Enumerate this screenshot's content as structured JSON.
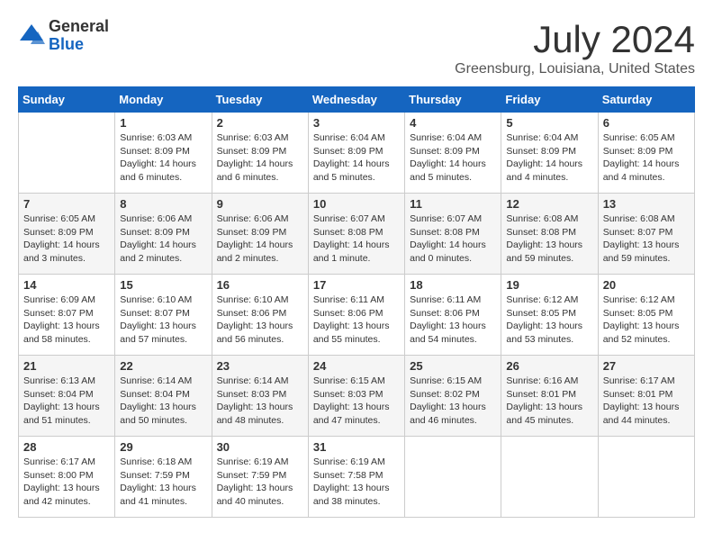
{
  "header": {
    "logo": {
      "general": "General",
      "blue": "Blue"
    },
    "month_title": "July 2024",
    "location": "Greensburg, Louisiana, United States"
  },
  "calendar": {
    "weekdays": [
      "Sunday",
      "Monday",
      "Tuesday",
      "Wednesday",
      "Thursday",
      "Friday",
      "Saturday"
    ],
    "weeks": [
      [
        {
          "day": "",
          "sunrise": "",
          "sunset": "",
          "daylight": ""
        },
        {
          "day": "1",
          "sunrise": "Sunrise: 6:03 AM",
          "sunset": "Sunset: 8:09 PM",
          "daylight": "Daylight: 14 hours and 6 minutes."
        },
        {
          "day": "2",
          "sunrise": "Sunrise: 6:03 AM",
          "sunset": "Sunset: 8:09 PM",
          "daylight": "Daylight: 14 hours and 6 minutes."
        },
        {
          "day": "3",
          "sunrise": "Sunrise: 6:04 AM",
          "sunset": "Sunset: 8:09 PM",
          "daylight": "Daylight: 14 hours and 5 minutes."
        },
        {
          "day": "4",
          "sunrise": "Sunrise: 6:04 AM",
          "sunset": "Sunset: 8:09 PM",
          "daylight": "Daylight: 14 hours and 5 minutes."
        },
        {
          "day": "5",
          "sunrise": "Sunrise: 6:04 AM",
          "sunset": "Sunset: 8:09 PM",
          "daylight": "Daylight: 14 hours and 4 minutes."
        },
        {
          "day": "6",
          "sunrise": "Sunrise: 6:05 AM",
          "sunset": "Sunset: 8:09 PM",
          "daylight": "Daylight: 14 hours and 4 minutes."
        }
      ],
      [
        {
          "day": "7",
          "sunrise": "Sunrise: 6:05 AM",
          "sunset": "Sunset: 8:09 PM",
          "daylight": "Daylight: 14 hours and 3 minutes."
        },
        {
          "day": "8",
          "sunrise": "Sunrise: 6:06 AM",
          "sunset": "Sunset: 8:09 PM",
          "daylight": "Daylight: 14 hours and 2 minutes."
        },
        {
          "day": "9",
          "sunrise": "Sunrise: 6:06 AM",
          "sunset": "Sunset: 8:09 PM",
          "daylight": "Daylight: 14 hours and 2 minutes."
        },
        {
          "day": "10",
          "sunrise": "Sunrise: 6:07 AM",
          "sunset": "Sunset: 8:08 PM",
          "daylight": "Daylight: 14 hours and 1 minute."
        },
        {
          "day": "11",
          "sunrise": "Sunrise: 6:07 AM",
          "sunset": "Sunset: 8:08 PM",
          "daylight": "Daylight: 14 hours and 0 minutes."
        },
        {
          "day": "12",
          "sunrise": "Sunrise: 6:08 AM",
          "sunset": "Sunset: 8:08 PM",
          "daylight": "Daylight: 13 hours and 59 minutes."
        },
        {
          "day": "13",
          "sunrise": "Sunrise: 6:08 AM",
          "sunset": "Sunset: 8:07 PM",
          "daylight": "Daylight: 13 hours and 59 minutes."
        }
      ],
      [
        {
          "day": "14",
          "sunrise": "Sunrise: 6:09 AM",
          "sunset": "Sunset: 8:07 PM",
          "daylight": "Daylight: 13 hours and 58 minutes."
        },
        {
          "day": "15",
          "sunrise": "Sunrise: 6:10 AM",
          "sunset": "Sunset: 8:07 PM",
          "daylight": "Daylight: 13 hours and 57 minutes."
        },
        {
          "day": "16",
          "sunrise": "Sunrise: 6:10 AM",
          "sunset": "Sunset: 8:06 PM",
          "daylight": "Daylight: 13 hours and 56 minutes."
        },
        {
          "day": "17",
          "sunrise": "Sunrise: 6:11 AM",
          "sunset": "Sunset: 8:06 PM",
          "daylight": "Daylight: 13 hours and 55 minutes."
        },
        {
          "day": "18",
          "sunrise": "Sunrise: 6:11 AM",
          "sunset": "Sunset: 8:06 PM",
          "daylight": "Daylight: 13 hours and 54 minutes."
        },
        {
          "day": "19",
          "sunrise": "Sunrise: 6:12 AM",
          "sunset": "Sunset: 8:05 PM",
          "daylight": "Daylight: 13 hours and 53 minutes."
        },
        {
          "day": "20",
          "sunrise": "Sunrise: 6:12 AM",
          "sunset": "Sunset: 8:05 PM",
          "daylight": "Daylight: 13 hours and 52 minutes."
        }
      ],
      [
        {
          "day": "21",
          "sunrise": "Sunrise: 6:13 AM",
          "sunset": "Sunset: 8:04 PM",
          "daylight": "Daylight: 13 hours and 51 minutes."
        },
        {
          "day": "22",
          "sunrise": "Sunrise: 6:14 AM",
          "sunset": "Sunset: 8:04 PM",
          "daylight": "Daylight: 13 hours and 50 minutes."
        },
        {
          "day": "23",
          "sunrise": "Sunrise: 6:14 AM",
          "sunset": "Sunset: 8:03 PM",
          "daylight": "Daylight: 13 hours and 48 minutes."
        },
        {
          "day": "24",
          "sunrise": "Sunrise: 6:15 AM",
          "sunset": "Sunset: 8:03 PM",
          "daylight": "Daylight: 13 hours and 47 minutes."
        },
        {
          "day": "25",
          "sunrise": "Sunrise: 6:15 AM",
          "sunset": "Sunset: 8:02 PM",
          "daylight": "Daylight: 13 hours and 46 minutes."
        },
        {
          "day": "26",
          "sunrise": "Sunrise: 6:16 AM",
          "sunset": "Sunset: 8:01 PM",
          "daylight": "Daylight: 13 hours and 45 minutes."
        },
        {
          "day": "27",
          "sunrise": "Sunrise: 6:17 AM",
          "sunset": "Sunset: 8:01 PM",
          "daylight": "Daylight: 13 hours and 44 minutes."
        }
      ],
      [
        {
          "day": "28",
          "sunrise": "Sunrise: 6:17 AM",
          "sunset": "Sunset: 8:00 PM",
          "daylight": "Daylight: 13 hours and 42 minutes."
        },
        {
          "day": "29",
          "sunrise": "Sunrise: 6:18 AM",
          "sunset": "Sunset: 7:59 PM",
          "daylight": "Daylight: 13 hours and 41 minutes."
        },
        {
          "day": "30",
          "sunrise": "Sunrise: 6:19 AM",
          "sunset": "Sunset: 7:59 PM",
          "daylight": "Daylight: 13 hours and 40 minutes."
        },
        {
          "day": "31",
          "sunrise": "Sunrise: 6:19 AM",
          "sunset": "Sunset: 7:58 PM",
          "daylight": "Daylight: 13 hours and 38 minutes."
        },
        {
          "day": "",
          "sunrise": "",
          "sunset": "",
          "daylight": ""
        },
        {
          "day": "",
          "sunrise": "",
          "sunset": "",
          "daylight": ""
        },
        {
          "day": "",
          "sunrise": "",
          "sunset": "",
          "daylight": ""
        }
      ]
    ]
  }
}
